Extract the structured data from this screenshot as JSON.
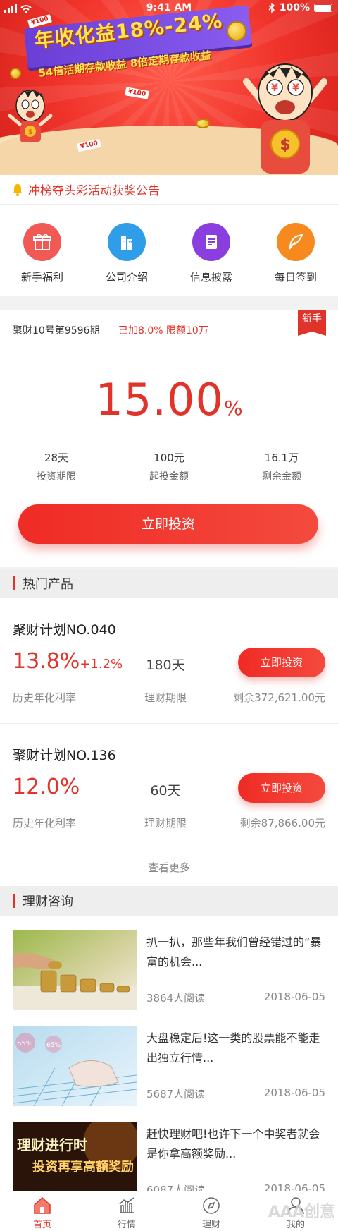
{
  "status_bar": {
    "time": "9:41 AM",
    "battery": "100%"
  },
  "banner": {
    "headline": "年收化益18%-24%",
    "subline": "54倍活期存款收益  8倍定期存款收益",
    "tag_amount": "¥100",
    "coin_symbol": "$"
  },
  "notice": {
    "text": "冲榜夺头彩活动获奖公告"
  },
  "quick_nav": [
    {
      "label": "新手福利",
      "icon": "gift-icon",
      "color": "#f15a54"
    },
    {
      "label": "公司介绍",
      "icon": "building-icon",
      "color": "#2f9de8"
    },
    {
      "label": "信息披露",
      "icon": "document-icon",
      "color": "#8a3ee0"
    },
    {
      "label": "每日签到",
      "icon": "feather-pen-icon",
      "color": "#f68a1e"
    }
  ],
  "featured": {
    "title": "聚财10号第9596期",
    "promo": "已加8.0% 限额10万",
    "new_tag": "新手",
    "rate": "15.00",
    "rate_unit": "%",
    "stats": [
      {
        "value": "28天",
        "label": "投资期限"
      },
      {
        "value": "100元",
        "label": "起投金额"
      },
      {
        "value": "16.1万",
        "label": "剩余金额"
      }
    ],
    "button": "立即投资"
  },
  "hot_section": {
    "title": "热门产品"
  },
  "products": [
    {
      "name": "聚财计划NO.040",
      "rate": "13.8%",
      "extra": "+1.2%",
      "period": "180天",
      "button": "立即投资",
      "rate_label": "历史年化利率",
      "period_label": "理财期限",
      "remaining": "剩余372,621.00元"
    },
    {
      "name": "聚财计划NO.136",
      "rate": "12.0%",
      "extra": "",
      "period": "60天",
      "button": "立即投资",
      "rate_label": "历史年化利率",
      "period_label": "理财期限",
      "remaining": "剩余87,866.00元"
    }
  ],
  "more": "查看更多",
  "news_section": {
    "title": "理财咨询"
  },
  "articles": [
    {
      "title": "扒一扒，那些年我们曾经错过的“暴富的机会...",
      "reads": "3864人阅读",
      "date": "2018-06-05"
    },
    {
      "title": "大盘稳定后!这一类的股票能不能走出独立行情...",
      "reads": "5687人阅读",
      "date": "2018-06-05"
    },
    {
      "title": "赶快理财吧!也许下一个中奖者就会是你拿高额奖励...",
      "reads": "6087人阅读",
      "date": "2018-06-05"
    }
  ],
  "article_images": {
    "percent_a": "65%",
    "percent_b": "65%",
    "promo_line1": "理财进行时",
    "promo_line2": "投资再享高额奖励"
  },
  "tabbar": [
    {
      "label": "首页",
      "icon": "home-icon",
      "active": true
    },
    {
      "label": "行情",
      "icon": "bar-chart-icon",
      "active": false
    },
    {
      "label": "理财",
      "icon": "compass-icon",
      "active": false
    },
    {
      "label": "我的",
      "icon": "person-icon",
      "active": false
    }
  ],
  "watermark": "AAA创意"
}
